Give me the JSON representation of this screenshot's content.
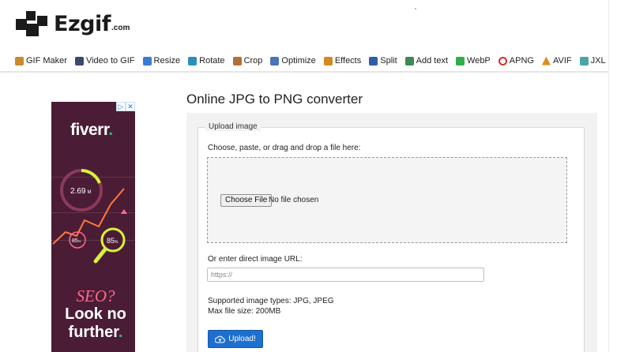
{
  "brand": {
    "name": "Ezgif",
    "suffix": ".com"
  },
  "nav": [
    {
      "label": "GIF Maker",
      "icon": "gif-maker-icon",
      "color": "#c98a2b"
    },
    {
      "label": "Video to GIF",
      "icon": "video-to-gif-icon",
      "color": "#3b4a6b"
    },
    {
      "label": "Resize",
      "icon": "resize-icon",
      "color": "#3a7bd5"
    },
    {
      "label": "Rotate",
      "icon": "rotate-icon",
      "color": "#2a8fbd"
    },
    {
      "label": "Crop",
      "icon": "crop-icon",
      "color": "#b0703a"
    },
    {
      "label": "Optimize",
      "icon": "optimize-icon",
      "color": "#4a76b8"
    },
    {
      "label": "Effects",
      "icon": "effects-icon",
      "color": "#d28a1e"
    },
    {
      "label": "Split",
      "icon": "split-icon",
      "color": "#2e5fa8"
    },
    {
      "label": "Add text",
      "icon": "add-text-icon",
      "color": "#3d8a52"
    },
    {
      "label": "WebP",
      "icon": "webp-icon",
      "color": "#2fae4a"
    },
    {
      "label": "APNG",
      "icon": "apng-icon",
      "color": "#d62a2a"
    },
    {
      "label": "AVIF",
      "icon": "avif-icon",
      "color": "#e08b20"
    },
    {
      "label": "JXL",
      "icon": "jxl-icon",
      "color": "#49a6a6"
    }
  ],
  "ad": {
    "brand": "fiverr",
    "brand_dot": ".",
    "metric_big": "2.69",
    "metric_big_unit": "M",
    "metric_small": "85",
    "metric_small_unit": "%",
    "metric_highlight": "85",
    "metric_highlight_unit": "%",
    "headline_1": "SEO?",
    "headline_2": "Look no",
    "headline_3": "further",
    "headline_dot": ".",
    "badge_info": "▷",
    "badge_close": "✕",
    "colors": {
      "bg": "#4b1c35",
      "accent": "#1dbf73",
      "pink": "#ff6b8b",
      "orange": "#ff7a3d",
      "lime": "#d7f23a"
    }
  },
  "main": {
    "title": "Online JPG to PNG converter",
    "legend": "Upload image",
    "choose_label": "Choose, paste, or drag and drop a file here:",
    "file_button": "Choose File",
    "file_status": "No file chosen",
    "url_label": "Or enter direct image URL:",
    "url_placeholder": "https://",
    "supported": "Supported image types: JPG, JPEG",
    "max_size": "Max file size: 200MB",
    "upload_button": "Upload!"
  },
  "colors": {
    "accent": "#1d6fd0",
    "panel": "#f2f2f2"
  }
}
